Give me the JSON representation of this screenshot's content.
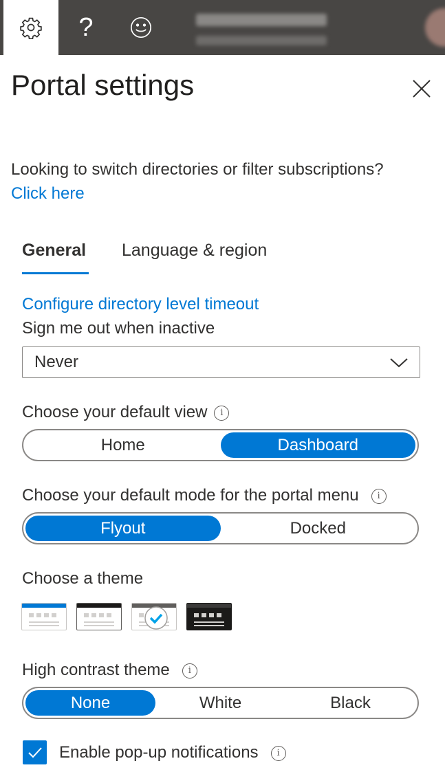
{
  "topbar": {
    "icons": [
      "gear-icon",
      "help-icon",
      "feedback-smiley-icon"
    ],
    "help_glyph": "?",
    "bg": "#484644"
  },
  "panel": {
    "title": "Portal settings",
    "intro_text": "Looking to switch directories or filter subscriptions?",
    "intro_link": "Click here",
    "tabs": [
      {
        "label": "General",
        "active": true
      },
      {
        "label": "Language & region",
        "active": false
      }
    ],
    "timeout_link": "Configure directory level timeout",
    "signout_label": "Sign me out when inactive",
    "signout_value": "Never",
    "default_view": {
      "label": "Choose your default view",
      "options": [
        "Home",
        "Dashboard"
      ],
      "selected": "Dashboard"
    },
    "menu_mode": {
      "label": "Choose your default mode for the portal menu",
      "options": [
        "Flyout",
        "Docked"
      ],
      "selected": "Flyout"
    },
    "theme": {
      "label": "Choose a theme",
      "options": [
        "azure-blue",
        "light-black",
        "light-gray",
        "dark"
      ],
      "selected": "light-gray"
    },
    "high_contrast": {
      "label": "High contrast theme",
      "options": [
        "None",
        "White",
        "Black"
      ],
      "selected": "None"
    },
    "popup": {
      "label": "Enable pop-up notifications",
      "checked": true
    },
    "info_glyph": "i"
  },
  "colors": {
    "accent": "#0078d4",
    "text": "#323130"
  }
}
